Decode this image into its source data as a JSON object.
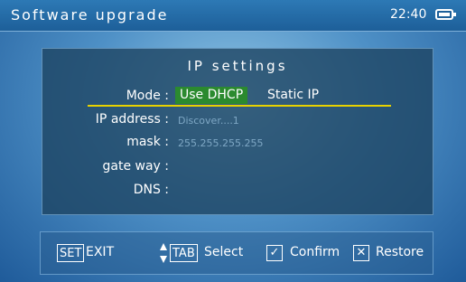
{
  "header": {
    "title": "Software upgrade",
    "time": "22:40"
  },
  "panel": {
    "title": "IP settings",
    "mode": {
      "label": "Mode :",
      "options": [
        "Use DHCP",
        "Static IP"
      ],
      "selected": "Use DHCP"
    },
    "ip_address": {
      "label": "IP address :",
      "value": "Discover....1"
    },
    "mask": {
      "label": "mask :",
      "value": "255.255.255.255"
    },
    "gateway": {
      "label": "gate way :",
      "value": ""
    },
    "dns": {
      "label": "DNS :",
      "value": ""
    }
  },
  "footer": {
    "set_key": "SET",
    "exit_label": "EXIT",
    "tab_key": "TAB",
    "select_label": "Select",
    "confirm_label": "Confirm",
    "restore_label": "Restore"
  },
  "colors": {
    "selected_bg": "#2b8a2f",
    "underline": "#e8d200",
    "hint_value": "#7ea7c4"
  }
}
